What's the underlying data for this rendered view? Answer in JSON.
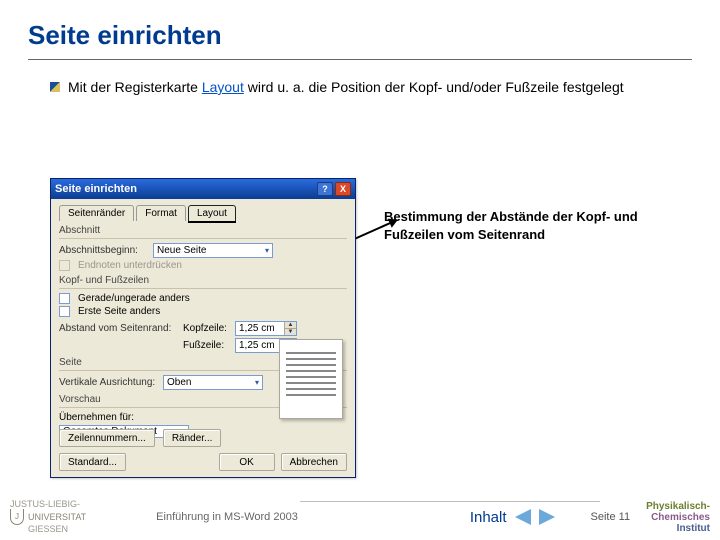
{
  "slide": {
    "title": "Seite einrichten",
    "bullet_pre": "Mit der Registerkarte ",
    "bullet_link": "Layout",
    "bullet_post": " wird u. a. die Position der Kopf- und/oder Fußzeile festgelegt",
    "annotation": "Bestimmung der Abstände der Kopf- und Fußzeilen vom Seitenrand"
  },
  "dialog": {
    "title": "Seite einrichten",
    "help_glyph": "?",
    "close_glyph": "X",
    "tabs": [
      "Seitenränder",
      "Format",
      "Layout"
    ],
    "active_tab_index": 2,
    "section": {
      "group": "Abschnitt",
      "begin_label": "Abschnittsbeginn:",
      "begin_value": "Neue Seite",
      "suppress_endnotes": "Endnoten unterdrücken"
    },
    "headers": {
      "group": "Kopf- und Fußzeilen",
      "odd_even": "Gerade/ungerade anders",
      "first_page": "Erste Seite anders",
      "distance_label": "Abstand vom Seitenrand:",
      "header_label": "Kopfzeile:",
      "header_value": "1,25 cm",
      "footer_label": "Fußzeile:",
      "footer_value": "1,25 cm"
    },
    "page": {
      "group": "Seite",
      "valign_label": "Vertikale Ausrichtung:",
      "valign_value": "Oben"
    },
    "previewg": {
      "group": "Vorschau",
      "apply_label": "Übernehmen für:",
      "apply_value": "Gesamtes Dokument"
    },
    "btn_line_numbers": "Zeilennummern...",
    "btn_borders": "Ränder...",
    "btn_default": "Standard...",
    "btn_ok": "OK",
    "btn_cancel": "Abbrechen"
  },
  "footer": {
    "uni_top": "JUSTUS-LIEBIG-",
    "uni_mid": "UNIVERSITAT",
    "uni_bot": "GIESSEN",
    "course": "Einführung in MS-Word 2003",
    "toc": "Inhalt",
    "page": "Seite 11",
    "inst_line1": "Physikalisch-",
    "inst_line2": "Chemisches",
    "inst_line3": "Institut"
  }
}
